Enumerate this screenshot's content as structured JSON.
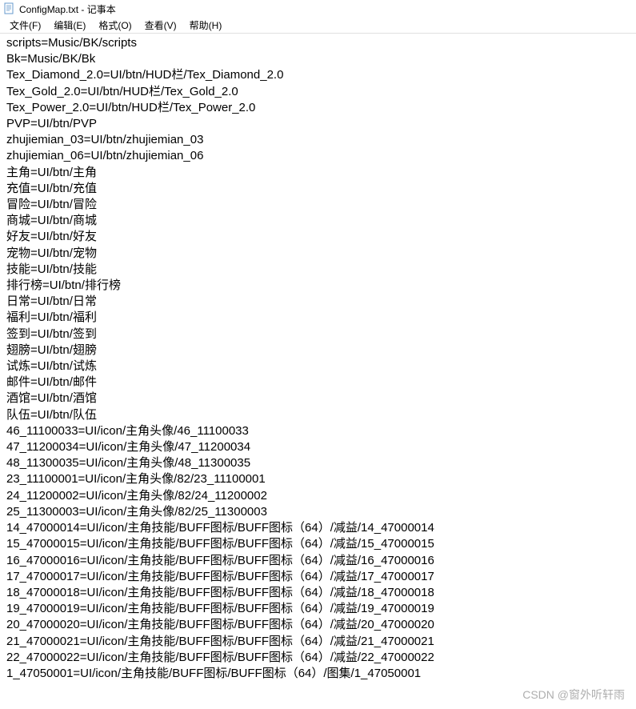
{
  "window": {
    "title": "ConfigMap.txt - 记事本"
  },
  "menu": {
    "file": "文件(F)",
    "edit": "编辑(E)",
    "format": "格式(O)",
    "view": "查看(V)",
    "help": "帮助(H)"
  },
  "content": {
    "lines": [
      "scripts=Music/BK/scripts",
      "Bk=Music/BK/Bk",
      "Tex_Diamond_2.0=UI/btn/HUD栏/Tex_Diamond_2.0",
      "Tex_Gold_2.0=UI/btn/HUD栏/Tex_Gold_2.0",
      "Tex_Power_2.0=UI/btn/HUD栏/Tex_Power_2.0",
      "PVP=UI/btn/PVP",
      "zhujiemian_03=UI/btn/zhujiemian_03",
      "zhujiemian_06=UI/btn/zhujiemian_06",
      "主角=UI/btn/主角",
      "充值=UI/btn/充值",
      "冒险=UI/btn/冒险",
      "商城=UI/btn/商城",
      "好友=UI/btn/好友",
      "宠物=UI/btn/宠物",
      "技能=UI/btn/技能",
      "排行榜=UI/btn/排行榜",
      "日常=UI/btn/日常",
      "福利=UI/btn/福利",
      "签到=UI/btn/签到",
      "翅膀=UI/btn/翅膀",
      "试炼=UI/btn/试炼",
      "邮件=UI/btn/邮件",
      "酒馆=UI/btn/酒馆",
      "队伍=UI/btn/队伍",
      "46_11100033=UI/icon/主角头像/46_11100033",
      "47_11200034=UI/icon/主角头像/47_11200034",
      "48_11300035=UI/icon/主角头像/48_11300035",
      "23_11100001=UI/icon/主角头像/82/23_11100001",
      "24_11200002=UI/icon/主角头像/82/24_11200002",
      "25_11300003=UI/icon/主角头像/82/25_11300003",
      "14_47000014=UI/icon/主角技能/BUFF图标/BUFF图标（64）/减益/14_47000014",
      "15_47000015=UI/icon/主角技能/BUFF图标/BUFF图标（64）/减益/15_47000015",
      "16_47000016=UI/icon/主角技能/BUFF图标/BUFF图标（64）/减益/16_47000016",
      "17_47000017=UI/icon/主角技能/BUFF图标/BUFF图标（64）/减益/17_47000017",
      "18_47000018=UI/icon/主角技能/BUFF图标/BUFF图标（64）/减益/18_47000018",
      "19_47000019=UI/icon/主角技能/BUFF图标/BUFF图标（64）/减益/19_47000019",
      "20_47000020=UI/icon/主角技能/BUFF图标/BUFF图标（64）/减益/20_47000020",
      "21_47000021=UI/icon/主角技能/BUFF图标/BUFF图标（64）/减益/21_47000021",
      "22_47000022=UI/icon/主角技能/BUFF图标/BUFF图标（64）/减益/22_47000022",
      "1_47050001=UI/icon/主角技能/BUFF图标/BUFF图标（64）/图集/1_47050001"
    ]
  },
  "watermark": "CSDN @窗外听轩雨"
}
